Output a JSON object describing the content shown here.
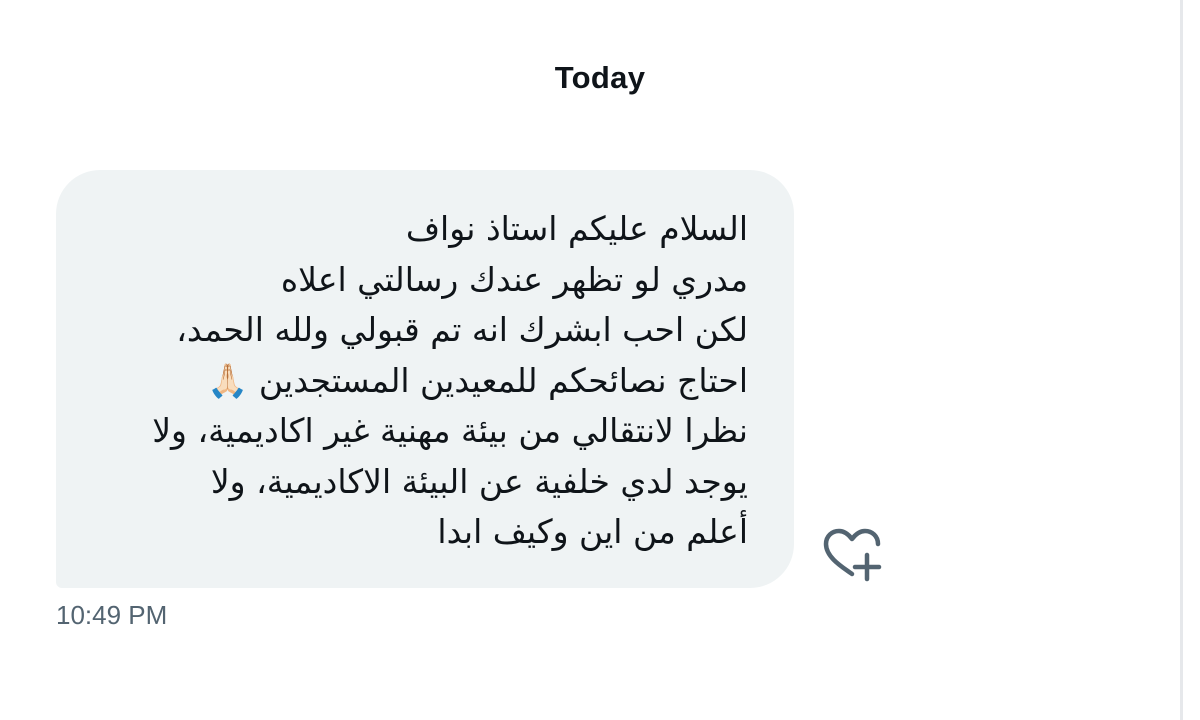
{
  "conversation": {
    "date_separator": "Today",
    "messages": [
      {
        "text": "السلام عليكم استاذ نواف\nمدري لو تظهر عندك رسالتي اعلاه\nلكن احب ابشرك انه تم قبولي ولله الحمد،\nاحتاج نصائحكم للمعيدين المستجدين 🙏🏻\nنظرا لانتقالي من بيئة مهنية غير اكاديمية، ولا\nيوجد لدي خلفية عن البيئة الاكاديمية، ولا\nأعلم من اين وكيف ابدا",
        "timestamp": "10:49 PM",
        "direction": "incoming"
      }
    ],
    "react_icon": "heart-plus-icon"
  },
  "colors": {
    "bubble_background": "#eff3f4",
    "text": "#0f1419",
    "timestamp": "#536471",
    "icon": "#536471"
  }
}
